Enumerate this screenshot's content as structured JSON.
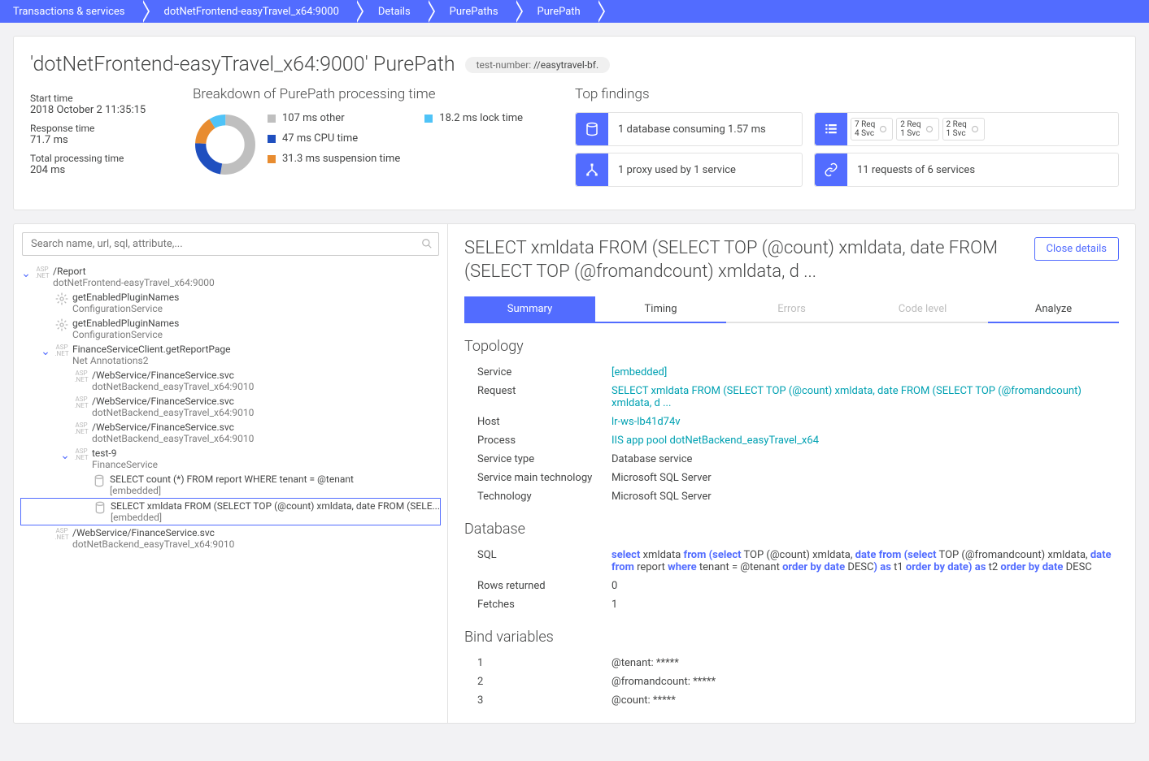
{
  "breadcrumb": [
    "Transactions & services",
    "dotNetFrontend-easyTravel_x64:9000",
    "Details",
    "PurePaths",
    "PurePath"
  ],
  "header": {
    "title": "'dotNetFrontend-easyTravel_x64:9000' PurePath",
    "badge_label": "test-number:",
    "badge_value": "//easytravel-bf."
  },
  "meta": {
    "start_label": "Start time",
    "start_value": "2018 October 2 11:35:15",
    "resp_label": "Response time",
    "resp_value": "71.7 ms",
    "total_label": "Total processing time",
    "total_value": "204 ms"
  },
  "breakdown": {
    "title": "Breakdown of PurePath processing time",
    "items": [
      {
        "label": "107 ms other",
        "color": "#bfbfbf"
      },
      {
        "label": "47 ms CPU time",
        "color": "#1f4fbf"
      },
      {
        "label": "31.3 ms suspension time",
        "color": "#e88c30"
      },
      {
        "label": "18.2 ms lock time",
        "color": "#4fc3f7"
      }
    ]
  },
  "chart_data": {
    "type": "pie",
    "title": "Breakdown of PurePath processing time",
    "series": [
      {
        "name": "other",
        "value": 107,
        "unit": "ms",
        "color": "#bfbfbf"
      },
      {
        "name": "CPU time",
        "value": 47,
        "unit": "ms",
        "color": "#1f4fbf"
      },
      {
        "name": "suspension time",
        "value": 31.3,
        "unit": "ms",
        "color": "#e88c30"
      },
      {
        "name": "lock time",
        "value": 18.2,
        "unit": "ms",
        "color": "#4fc3f7"
      }
    ]
  },
  "findings": {
    "title": "Top findings",
    "f1": "1 database consuming 1.57 ms",
    "f2": "1 proxy used by 1 service",
    "f3": "11 requests of 6 services",
    "chips": [
      {
        "l1": "7 Req",
        "l2": "4 Svc"
      },
      {
        "l1": "2 Req",
        "l2": "1 Svc"
      },
      {
        "l1": "2 Req",
        "l2": "1 Svc"
      }
    ]
  },
  "search_placeholder": "Search name, url, sql, attribute,...",
  "tree": [
    {
      "indent": 0,
      "expand": true,
      "icon": "asp",
      "title": "/Report",
      "sub": "dotNetFrontend-easyTravel_x64:9000"
    },
    {
      "indent": 1,
      "icon": "svc",
      "title": "getEnabledPluginNames",
      "sub": "ConfigurationService"
    },
    {
      "indent": 1,
      "icon": "svc",
      "title": "getEnabledPluginNames",
      "sub": "ConfigurationService"
    },
    {
      "indent": 1,
      "expand": true,
      "icon": "asp",
      "title": "FinanceServiceClient.getReportPage",
      "sub": "Net Annotations2"
    },
    {
      "indent": 2,
      "icon": "asp",
      "title": "/WebService/FinanceService.svc",
      "sub": "dotNetBackend_easyTravel_x64:9010"
    },
    {
      "indent": 2,
      "icon": "asp",
      "title": "/WebService/FinanceService.svc",
      "sub": "dotNetBackend_easyTravel_x64:9010"
    },
    {
      "indent": 2,
      "icon": "asp",
      "title": "/WebService/FinanceService.svc",
      "sub": "dotNetBackend_easyTravel_x64:9010"
    },
    {
      "indent": 2,
      "expand": true,
      "icon": "asp",
      "title": "test-9",
      "sub": "FinanceService"
    },
    {
      "indent": 3,
      "icon": "db",
      "title": "SELECT count (*) FROM report WHERE tenant = @tenant",
      "sub": "[embedded]"
    },
    {
      "indent": 3,
      "icon": "db",
      "title": "SELECT xmldata FROM (SELECT TOP (@count) xmldata, date FROM (SELE...",
      "sub": "[embedded]",
      "selected": true
    },
    {
      "indent": 1,
      "icon": "asp",
      "title": "/WebService/FinanceService.svc",
      "sub": "dotNetBackend_easyTravel_x64:9010"
    }
  ],
  "detail": {
    "title": "SELECT xmldata FROM (SELECT TOP (@count) xmldata, date FROM (SELECT TOP (@fromandcount) xmldata, d ...",
    "close": "Close details",
    "tabs": [
      "Summary",
      "Timing",
      "Errors",
      "Code level",
      "Analyze"
    ],
    "topology_title": "Topology",
    "topology": {
      "service_k": "Service",
      "service_v": "[embedded]",
      "request_k": "Request",
      "request_v": "SELECT xmldata FROM (SELECT TOP (@count) xmldata, date FROM (SELECT TOP (@fromandcount) xmldata, d ...",
      "host_k": "Host",
      "host_v": "lr-ws-lb41d74v",
      "process_k": "Process",
      "process_v": "IIS app pool dotNetBackend_easyTravel_x64",
      "stype_k": "Service type",
      "stype_v": "Database service",
      "tech_k": "Service main technology",
      "tech_v": "Microsoft SQL Server",
      "tech2_k": "Technology",
      "tech2_v": "Microsoft SQL Server"
    },
    "database_title": "Database",
    "database": {
      "sql_k": "SQL",
      "rows_k": "Rows returned",
      "rows_v": "0",
      "fetch_k": "Fetches",
      "fetch_v": "1"
    },
    "sql_tokens": [
      {
        "t": "select",
        "kw": 1
      },
      {
        "t": " xmldata "
      },
      {
        "t": "from",
        "kw": 1
      },
      {
        "t": " "
      },
      {
        "t": "(",
        "kw": 1
      },
      {
        "t": "select",
        "kw": 1
      },
      {
        "t": " TOP (@count) xmldata, "
      },
      {
        "t": "date from",
        "kw": 1
      },
      {
        "t": " "
      },
      {
        "t": "(",
        "kw": 1
      },
      {
        "t": "select",
        "kw": 1
      },
      {
        "t": " TOP (@fromandcount) xmldata, "
      },
      {
        "t": "date from",
        "kw": 1
      },
      {
        "t": " report "
      },
      {
        "t": "where",
        "kw": 1
      },
      {
        "t": " tenant = @tenant "
      },
      {
        "t": "order by date",
        "kw": 1
      },
      {
        "t": " DESC"
      },
      {
        "t": ")",
        "kw": 1
      },
      {
        "t": " "
      },
      {
        "t": "as",
        "kw": 1
      },
      {
        "t": " t1 "
      },
      {
        "t": "order by date",
        "kw": 1
      },
      {
        "t": ")",
        "kw": 1
      },
      {
        "t": " "
      },
      {
        "t": "as",
        "kw": 1
      },
      {
        "t": " t2 "
      },
      {
        "t": "order by date",
        "kw": 1
      },
      {
        "t": " DESC"
      }
    ],
    "bind_title": "Bind variables",
    "bind": [
      {
        "k": "1",
        "v": "@tenant: *****"
      },
      {
        "k": "2",
        "v": "@fromandcount: *****"
      },
      {
        "k": "3",
        "v": "@count: *****"
      }
    ]
  }
}
